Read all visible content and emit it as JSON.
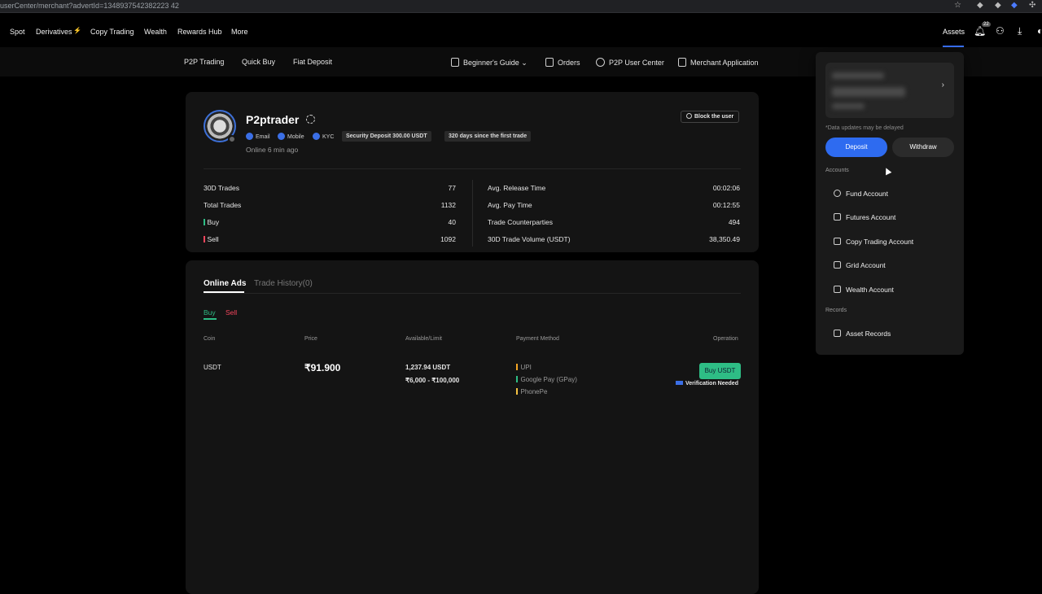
{
  "browser": {
    "url": "userCenter/merchant?advertId=1348937542382223 42"
  },
  "topnav": {
    "items": [
      "Spot",
      "Derivatives",
      "Copy Trading",
      "Wealth",
      "Rewards Hub",
      "More"
    ],
    "assets_label": "Assets",
    "notification_count": "22"
  },
  "subnav": {
    "items": [
      "P2P Trading",
      "Quick Buy",
      "Fiat Deposit"
    ],
    "beginners_guide": "Beginner's Guide",
    "orders": "Orders",
    "p2p_user_center": "P2P User Center",
    "merchant_application": "Merchant Application"
  },
  "profile": {
    "name": "P2ptrader",
    "chips": [
      "Email",
      "Mobile",
      "KYC"
    ],
    "security_deposit": "Security Deposit 300.00 USDT",
    "days_since": "320 days since the first trade",
    "online": "Online 6 min ago",
    "block_button": "Block the user",
    "stats_left": [
      {
        "label": "30D Trades",
        "value": "77"
      },
      {
        "label": "Total Trades",
        "value": "1132"
      },
      {
        "label": "Buy",
        "value": "40"
      },
      {
        "label": "Sell",
        "value": "1092"
      }
    ],
    "stats_right": [
      {
        "label": "Avg. Release Time",
        "value": "00:02:06"
      },
      {
        "label": "Avg. Pay Time",
        "value": "00:12:55"
      },
      {
        "label": "Trade Counterparties",
        "value": "494"
      },
      {
        "label": "30D Trade Volume (USDT)",
        "value": "38,350.49"
      }
    ]
  },
  "ads": {
    "tabs": [
      "Online Ads",
      "Trade History(0)"
    ],
    "subtabs": [
      "Buy",
      "Sell"
    ],
    "columns": [
      "Coin",
      "Price",
      "Available/Limit",
      "Payment Method",
      "Operation"
    ],
    "row": {
      "coin": "USDT",
      "price": "₹91.900",
      "available": "1,237.94 USDT",
      "limit": "₹6,000 - ₹100,000",
      "payments": [
        "UPI",
        "Google Pay (GPay)",
        "PhonePe"
      ],
      "button": "Buy USDT",
      "verification": "Verification Needed"
    }
  },
  "dropdown": {
    "delayed_note": "*Data updates may be delayed",
    "deposit": "Deposit",
    "withdraw": "Withdraw",
    "accounts_label": "Accounts",
    "accounts": [
      "Fund Account",
      "Futures Account",
      "Copy Trading Account",
      "Grid Account",
      "Wealth Account"
    ],
    "records_label": "Records",
    "records": [
      "Asset Records"
    ]
  },
  "colors": {
    "accent_blue": "#2e6bf0",
    "buy_green": "#2ebd85",
    "sell_red": "#f6465d"
  }
}
